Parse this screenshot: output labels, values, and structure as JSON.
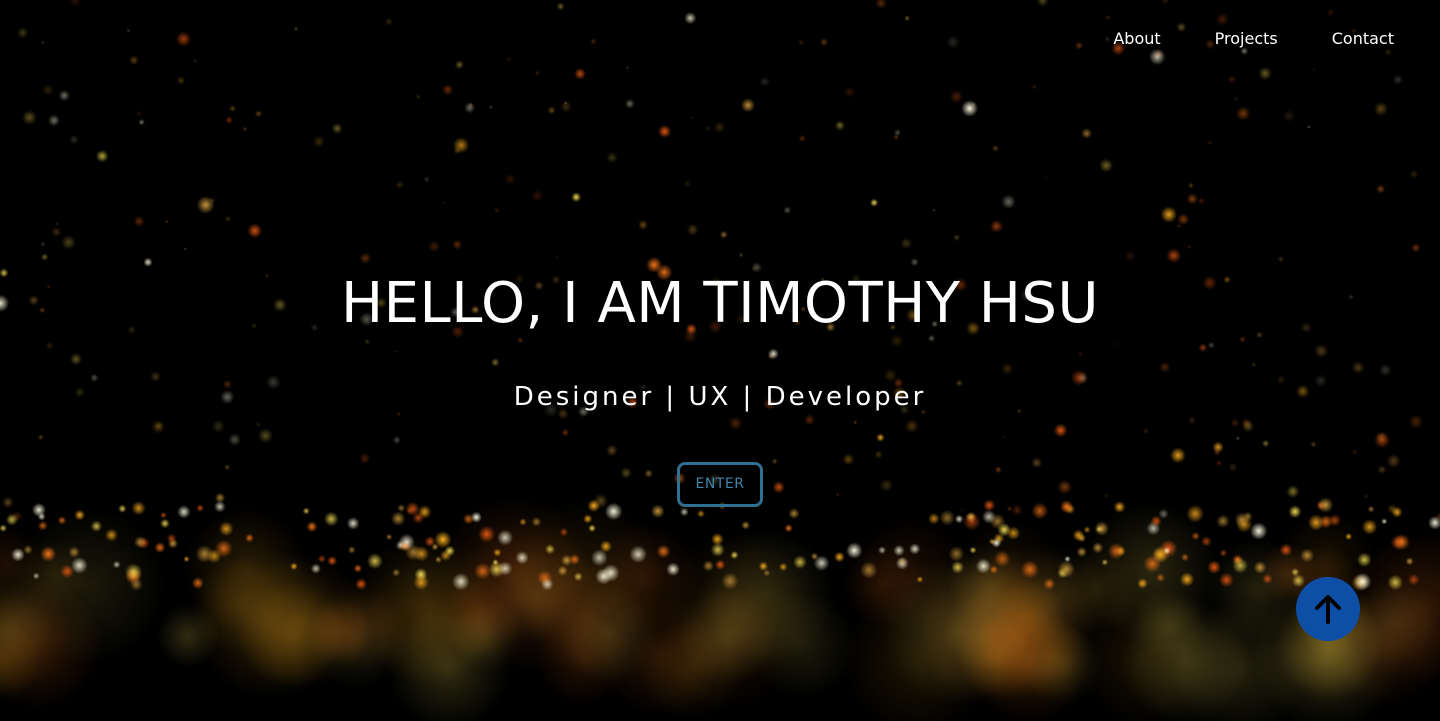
{
  "nav": {
    "items": [
      {
        "label": "About"
      },
      {
        "label": "Projects"
      },
      {
        "label": "Contact"
      }
    ]
  },
  "hero": {
    "title": "HELLO, I AM TIMOTHY HSU",
    "subtitle": "Designer | UX | Developer",
    "enter_label": "ENTER"
  },
  "scroll_top": {
    "icon": "arrow-up-icon"
  },
  "colors": {
    "background": "#000000",
    "accent_button": "#0d4fa6",
    "enter_border": "#2f6f90",
    "enter_text": "#3f86aa",
    "bokeh_warm": "#ffb020",
    "bokeh_orange": "#ff7a1a",
    "bokeh_white": "#fffbe0"
  }
}
